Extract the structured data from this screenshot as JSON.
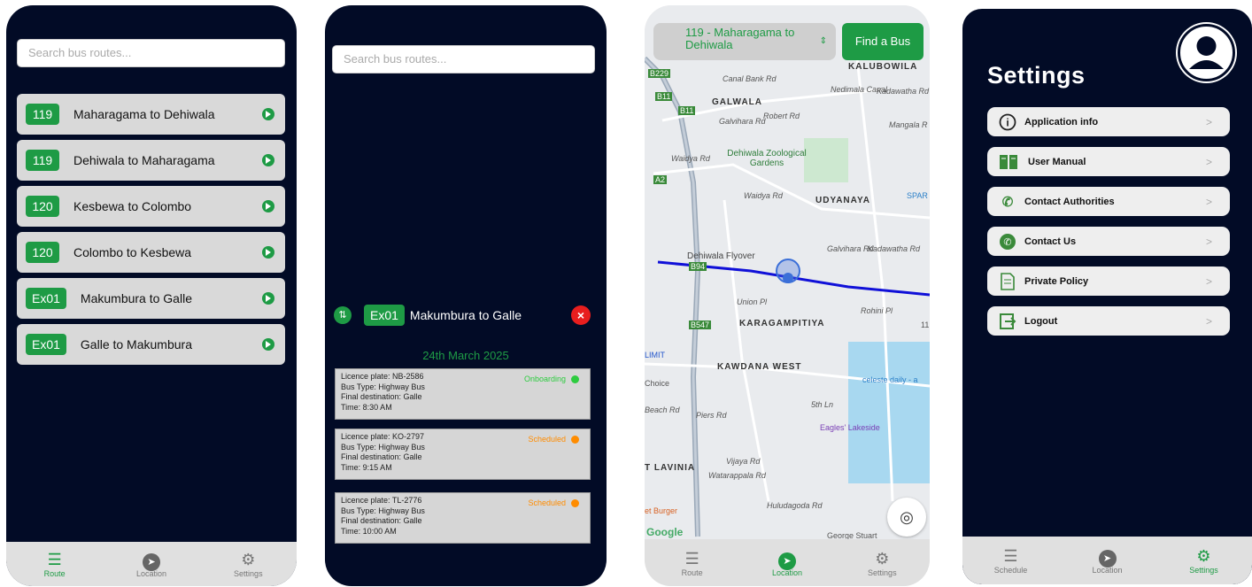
{
  "routes_screen": {
    "search_placeholder": "Search bus routes...",
    "routes": [
      {
        "num": "119",
        "name": "Maharagama to Dehiwala"
      },
      {
        "num": "119",
        "name": "Dehiwala to Maharagama"
      },
      {
        "num": "120",
        "name": "Kesbewa to Colombo"
      },
      {
        "num": "120",
        "name": "Colombo to Kesbewa"
      },
      {
        "num": "Ex01",
        "name": "Makumbura to Galle"
      },
      {
        "num": "Ex01",
        "name": "Galle to Makumbura"
      }
    ],
    "tabs": {
      "route": "Route",
      "location": "Location",
      "settings": "Settings"
    }
  },
  "schedule_screen": {
    "search_placeholder": "Search bus routes...",
    "route_num": "Ex01",
    "route_name": "Makumbura to Galle",
    "date": "24th March 2025",
    "buses": [
      {
        "plate": "Licence plate: NB-2586",
        "type": "Bus Type: Highway Bus",
        "dest": "Final destination: Galle",
        "time": "Time: 8:30 AM",
        "status": "Onboarding",
        "status_color": "#2ecc40"
      },
      {
        "plate": "Licence plate: KO-2797",
        "type": "Bus Type: Highway Bus",
        "dest": "Final destination: Galle",
        "time": "Time: 9:15 AM",
        "status": "Scheduled",
        "status_color": "#ff8c00"
      },
      {
        "plate": "Licence plate: TL-2776",
        "type": "Bus Type: Highway Bus",
        "dest": "Final destination: Galle",
        "time": "Time: 10:00 AM",
        "status": "Scheduled",
        "status_color": "#ff8c00"
      }
    ]
  },
  "map_screen": {
    "route_select": "119 - Maharagama to Dehiwala",
    "find_button": "Find a Bus",
    "labels": {
      "kalubowila": "KALUBOWILA",
      "galwala": "GALWALA",
      "zoo": "Dehiwala Zoological Gardens",
      "udyanaya": "UDYANAYA",
      "flyover": "Dehiwala Flyover",
      "karagampitiya": "KARAGAMPITIYA",
      "kawdana": "KAWDANA WEST",
      "limit": "LIMIT",
      "choice": "Choice",
      "beach": "Beach Rd",
      "celeste": "celeste daily - a",
      "eagles": "Eagles' Lakeside",
      "lavinia": "T LAVINIA",
      "burger": "et Burger",
      "google": "Google",
      "waidya": "Waidya Rd",
      "waidya2": "Waidya Rd",
      "spar": "SPAR",
      "b229": "B229",
      "b11a": "B11",
      "b11b": "B11",
      "a2": "A2",
      "b94": "B94",
      "b547": "B547",
      "canal": "Canal Bank Rd",
      "galviharard": "Galvihara Rd",
      "robert": "Robert Rd",
      "kadawatha": "Kadawatha Rd",
      "mangala": "Mangala R",
      "nedimala": "Nedimala Canal",
      "piers": "Piers Rd",
      "vijaya": "Vijaya Rd",
      "watarappala": "Watarappala Rd",
      "union": "Union Pl",
      "rohini": "Rohini Pl",
      "galviharard2": "Galvihara Rd",
      "kadawatha2": "Kadawatha Rd",
      "fifth": "5th Ln",
      "eleven": "11",
      "george": "George Stuart",
      "hulud": "Huludagoda Rd"
    },
    "tabs": {
      "route": "Route",
      "location": "Location",
      "settings": "Settings"
    }
  },
  "settings_screen": {
    "title": "Settings",
    "items": [
      {
        "label": "Application info",
        "icon": "info-icon"
      },
      {
        "label": "User Manual",
        "icon": "book-icon"
      },
      {
        "label": "Contact Authorities",
        "icon": "phone-shield-icon"
      },
      {
        "label": "Contact Us",
        "icon": "phone-icon"
      },
      {
        "label": "Private Policy",
        "icon": "document-icon"
      },
      {
        "label": "Logout",
        "icon": "logout-icon"
      }
    ],
    "tabs": {
      "schedule": "Schedule",
      "location": "Location",
      "settings": "Settings"
    }
  },
  "colors": {
    "accent": "#1e9b45",
    "bg": "#020b26",
    "danger": "#e81e1e"
  }
}
